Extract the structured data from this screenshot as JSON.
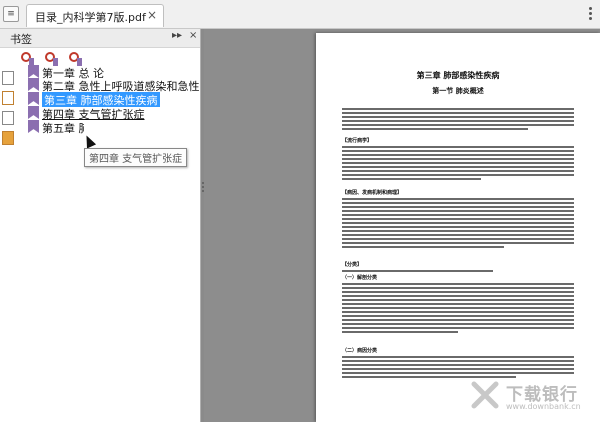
{
  "tab": {
    "title": "目录_内科学第7版.pdf",
    "close": "×"
  },
  "sidebar": {
    "title": "书签",
    "collapse_icon": "▸▸",
    "close_icon": "×",
    "bookmarks": [
      {
        "label": "第一章  总  论"
      },
      {
        "label": "第二章  急性上呼吸道感染和急性气管-支气管炎"
      },
      {
        "label": "第三章  肺部感染性疾病",
        "selected": true
      },
      {
        "label": "第四章  支气管扩张症"
      },
      {
        "label": "第五章  肺"
      }
    ],
    "tooltip": "第四章  支气管扩张症"
  },
  "page": {
    "chapter_title": "第三章    肺部感染性疾病",
    "section_title": "第一节    肺炎概述",
    "headings": [
      "【流行病学】",
      "【病因、发病机制和病理】",
      "【分类】",
      "（一）解剖分类",
      "（二）病因分类"
    ]
  },
  "watermark": {
    "text": "下载银行",
    "url": "www.downbank.cn"
  }
}
